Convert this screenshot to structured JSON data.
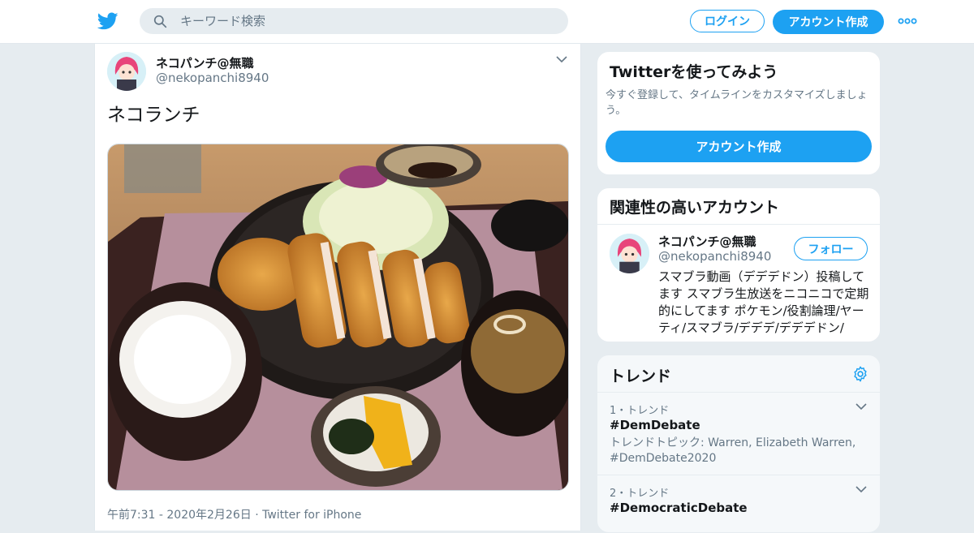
{
  "header": {
    "search_placeholder": "キーワード検索",
    "login_label": "ログイン",
    "signup_label": "アカウント作成",
    "brand_color": "#1da1f2"
  },
  "tweet": {
    "author_name": "ネコパンチ@無職",
    "author_handle": "@nekopanchi8940",
    "text": "ネコランチ",
    "photo_description_icons": [
      "rice-bowl",
      "tonkatsu-plate",
      "miso-soup",
      "pickles"
    ],
    "footer": "午前7:31 - 2020年2月26日 · Twitter for iPhone"
  },
  "signup_card": {
    "title": "Twitterを使ってみよう",
    "description": "今すぐ登録して、タイムラインをカスタマイズしましょう。",
    "button_label": "アカウント作成"
  },
  "related": {
    "title": "関連性の高いアカウント",
    "account": {
      "name": "ネコパンチ@無職",
      "handle": "@nekopanchi8940",
      "follow_label": "フォロー",
      "bio": "スマブラ動画（デデデドン）投稿してます スマブラ生放送をニコニコで定期的にしてます ポケモン/役割論理/ヤーティ/スマブラ/デデデ/デデデドン/"
    }
  },
  "trends": {
    "title": "トレンド",
    "items": [
      {
        "meta": "1・トレンド",
        "name": "#DemDebate",
        "desc": "トレンドトピック: Warren, Elizabeth Warren, #DemDebate2020"
      },
      {
        "meta": "2・トレンド",
        "name": "#DemocraticDebate",
        "desc": ""
      }
    ]
  }
}
